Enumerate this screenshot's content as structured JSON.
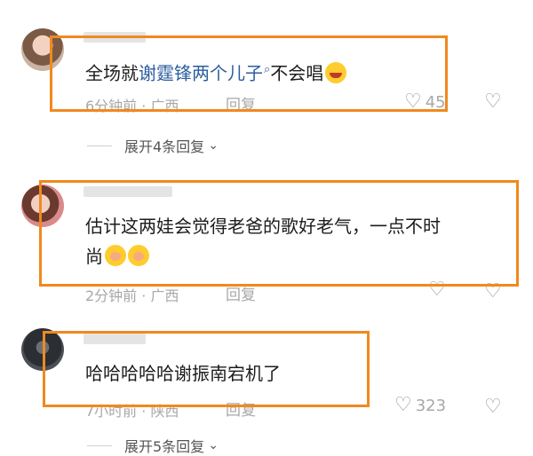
{
  "comments": [
    {
      "text_before": "全场就",
      "text_highlight": "谢霆锋两个儿子",
      "text_after": "不会唱",
      "emoji": "laugh-emoji",
      "time": "6分钟前",
      "location": "广西",
      "reply": "回复",
      "likes": "45",
      "expand": "展开4条回复"
    },
    {
      "text_line1": "估计这两娃会觉得老爸的歌好老气，一点不时",
      "text_line2": "尚",
      "emoji": "shy-emoji",
      "time": "2分钟前",
      "location": "广西",
      "reply": "回复"
    },
    {
      "text": "哈哈哈哈哈谢振南宕机了",
      "time": "7小时前",
      "location": "陕西",
      "reply": "回复",
      "likes": "323",
      "expand": "展开5条回复"
    }
  ],
  "colors": {
    "highlight": "#f0891e",
    "link": "#2c5e9e"
  },
  "icons": {
    "like": "heart-icon",
    "dislike": "broken-heart-icon",
    "search": "search-icon",
    "expand": "chevron-down-icon"
  }
}
